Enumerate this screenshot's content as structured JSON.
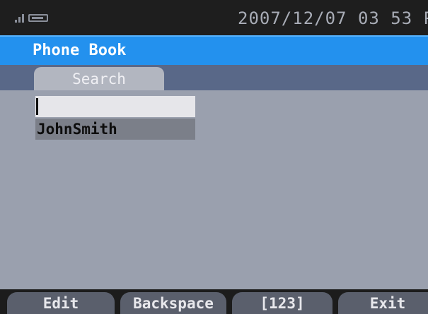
{
  "status_bar": {
    "datetime": "2007/12/07 03 53 P",
    "signal_icon": "signal-icon",
    "battery_icon": "battery-icon"
  },
  "title_bar": {
    "title": "Phone Book"
  },
  "tabs": [
    {
      "label": "Search",
      "active": true
    }
  ],
  "search": {
    "value": "",
    "placeholder": ""
  },
  "results": [
    {
      "name": "JohnSmith",
      "selected": true
    }
  ],
  "softkeys": [
    {
      "label": "Edit"
    },
    {
      "label": "Backspace"
    },
    {
      "label": "[123]"
    },
    {
      "label": "Exit"
    }
  ],
  "colors": {
    "title_bar": "#2391ee",
    "status_bar": "#1e1e1e",
    "content_bg": "#9aa0ae",
    "tab_strip": "#596888",
    "selected_item": "#7b7f89"
  }
}
